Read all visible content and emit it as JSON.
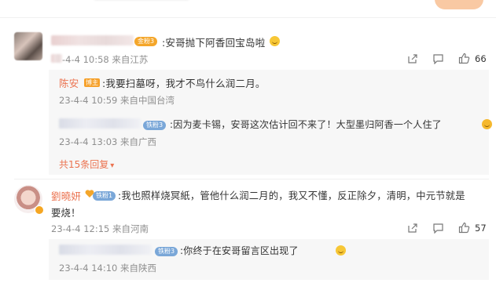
{
  "comment1": {
    "badge": "金粉3",
    "text": ":安哥抛下阿香回宝岛啦",
    "meta": "-4-4 10:58 来自江苏",
    "likes": "66",
    "replies": [
      {
        "name": "陈安",
        "badge": "博主",
        "text": ":我要扫墓呀，我才不鸟什么润二月。",
        "meta": "23-4-4 10:59 来自中国台湾"
      },
      {
        "badge": "铁粉3",
        "text": ":因为麦卡锡，安哥这次估计回不来了！大型墨归阿香一个人住了",
        "meta": "23-4-4 13:03 来自广西"
      }
    ],
    "more_replies": "共15条回复",
    "more_arrow": "▾"
  },
  "comment2": {
    "name": "劉曉妍",
    "badge": "铁粉1",
    "text_line1": ":我也照样烧冥紙，管他什么润二月的，我又不懂，反正除夕，清明，中元节就是",
    "text_line2": "要烧！",
    "meta": "23-4-4 12:15 来自河南",
    "likes": "57",
    "replies": [
      {
        "badge": "铁粉3",
        "text": ":你终于在安哥留言区出现了",
        "meta": "23-4-4 14:10 来自陕西"
      }
    ]
  },
  "icons": {
    "share": "share-icon",
    "comment": "comment-icon",
    "like": "thumbs-up-icon",
    "emoji": "grin-emoji-icon",
    "laugh": "laugh-emoji-icon"
  },
  "colors": {
    "name_orange": "#eb7350",
    "meta_gray": "#8f8f8f",
    "fans_badge": "#f4a62a",
    "iron_badge": "#7aa7d8",
    "reply_bg": "#f7f7f7"
  }
}
